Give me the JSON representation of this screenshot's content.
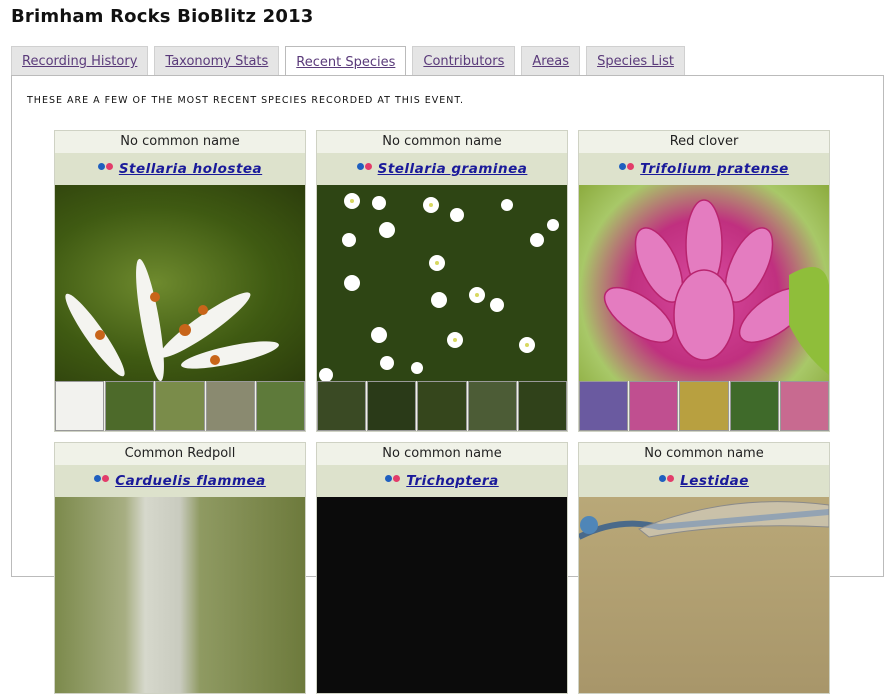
{
  "page": {
    "title": "Brimham Rocks BioBlitz 2013"
  },
  "tabs": [
    {
      "label": "Recording History"
    },
    {
      "label": "Taxonomy Stats"
    },
    {
      "label": "Recent Species"
    },
    {
      "label": "Contributors"
    },
    {
      "label": "Areas"
    },
    {
      "label": "Species List"
    }
  ],
  "panel": {
    "intro": "These are a few of the most recent species recorded at this event."
  },
  "cards": [
    {
      "common": "No common name",
      "scientific": "Stellaria holostea"
    },
    {
      "common": "No common name",
      "scientific": "Stellaria graminea"
    },
    {
      "common": "Red clover",
      "scientific": "Trifolium pratense"
    },
    {
      "common": "Common Redpoll",
      "scientific": "Carduelis flammea"
    },
    {
      "common": "No common name",
      "scientific": "Trichoptera"
    },
    {
      "common": "No common name",
      "scientific": "Lestidae"
    }
  ]
}
